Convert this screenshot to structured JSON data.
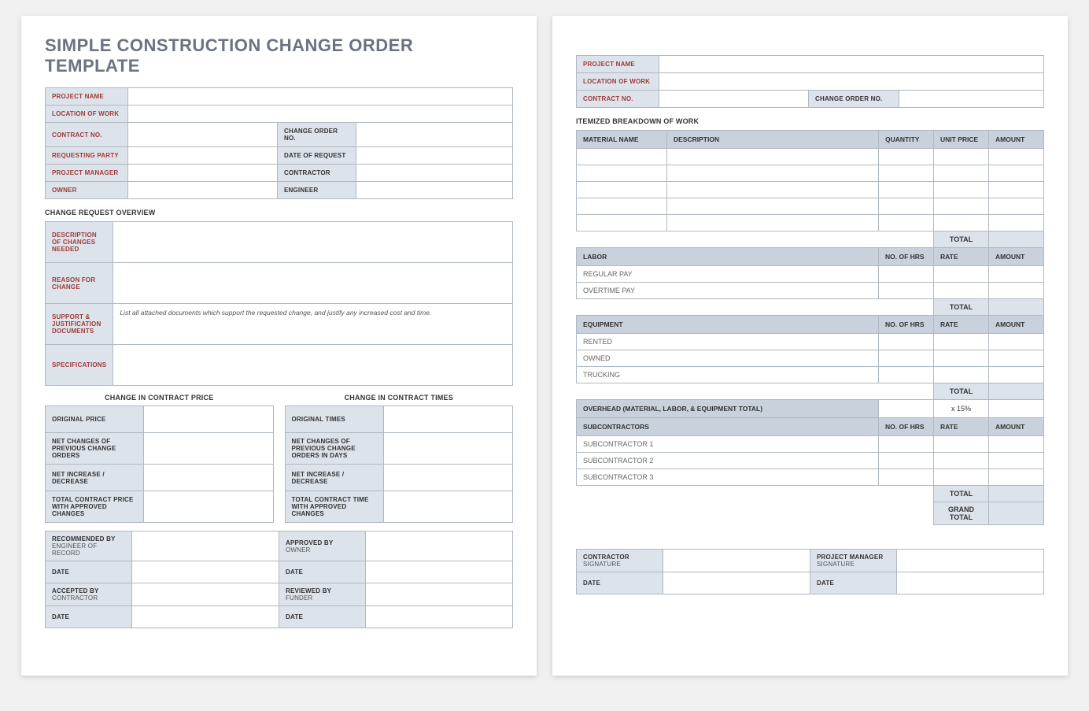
{
  "title": "SIMPLE CONSTRUCTION CHANGE ORDER TEMPLATE",
  "topGrid": {
    "projectName": "PROJECT NAME",
    "locationOfWork": "LOCATION OF WORK",
    "contractNo": "CONTRACT NO.",
    "changeOrderNo": "CHANGE ORDER NO.",
    "requestingParty": "REQUESTING PARTY",
    "dateOfRequest": "DATE OF REQUEST",
    "projectManager": "PROJECT MANAGER",
    "contractor": "CONTRACTOR",
    "owner": "OWNER",
    "engineer": "ENGINEER"
  },
  "overview": {
    "heading": "CHANGE REQUEST OVERVIEW",
    "descChanges": "DESCRIPTION OF CHANGES NEEDED",
    "reason": "REASON FOR CHANGE",
    "support": "SUPPORT & JUSTIFICATION DOCUMENTS",
    "supportHint": "List all attached documents which support the requested change, and justify any increased cost and time.",
    "specs": "SPECIFICATIONS"
  },
  "priceSection": {
    "priceHeading": "CHANGE IN CONTRACT PRICE",
    "timesHeading": "CHANGE IN CONTRACT TIMES",
    "origPrice": "ORIGINAL PRICE",
    "origTimes": "ORIGINAL TIMES",
    "netChangesPrev": "NET CHANGES OF PREVIOUS CHANGE ORDERS",
    "netChangesPrevDays": "NET CHANGES OF PREVIOUS CHANGE ORDERS IN DAYS",
    "netInc": "NET INCREASE / DECREASE",
    "totalPrice": "TOTAL CONTRACT PRICE WITH APPROVED CHANGES",
    "totalTime": "TOTAL CONTRACT TIME WITH APPROVED CHANGES"
  },
  "approvals": {
    "recommendedBy": "RECOMMENDED BY",
    "engineerOfRecord": "ENGINEER OF RECORD",
    "approvedBy": "APPROVED BY",
    "ownerSub": "OWNER",
    "date": "DATE",
    "acceptedBy": "ACCEPTED BY",
    "contractorSub": "CONTRACTOR",
    "reviewedBy": "REVIEWED BY",
    "funder": "FUNDER"
  },
  "page2": {
    "itemizedHeading": "ITEMIZED BREAKDOWN OF WORK",
    "material": {
      "name": "MATERIAL NAME",
      "description": "DESCRIPTION",
      "quantity": "QUANTITY",
      "unitPrice": "UNIT PRICE",
      "amount": "AMOUNT"
    },
    "total": "TOTAL",
    "labor": {
      "heading": "LABOR",
      "hrs": "NO. OF HRS",
      "rate": "RATE",
      "amount": "AMOUNT",
      "regular": "REGULAR PAY",
      "overtime": "OVERTIME PAY"
    },
    "equipment": {
      "heading": "EQUIPMENT",
      "rented": "RENTED",
      "owned": "OWNED",
      "trucking": "TRUCKING"
    },
    "overhead": {
      "heading": "OVERHEAD (MATERIAL, LABOR, & EQUIPMENT TOTAL)",
      "rate": "x 15%"
    },
    "subcontractors": {
      "heading": "SUBCONTRACTORS",
      "s1": "SUBCONTRACTOR 1",
      "s2": "SUBCONTRACTOR 2",
      "s3": "SUBCONTRACTOR 3"
    },
    "grandTotal": "GRAND TOTAL",
    "sig": {
      "contractor": "CONTRACTOR",
      "signature": "SIGNATURE",
      "pm": "PROJECT MANAGER",
      "date": "DATE"
    }
  }
}
